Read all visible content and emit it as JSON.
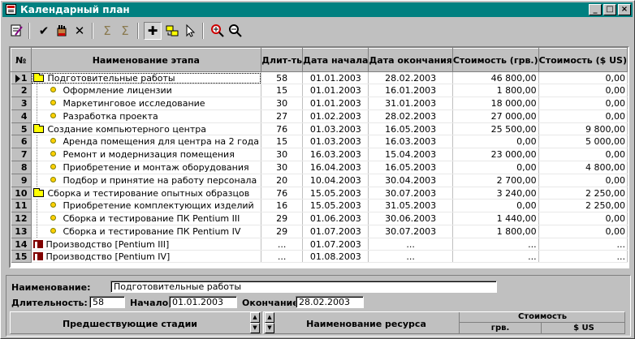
{
  "window": {
    "title": "Календарный план",
    "controls": [
      "_",
      "□",
      "×"
    ]
  },
  "toolbar": {
    "buttons": [
      {
        "icon": "document-edit-icon"
      },
      {
        "icon": "checkmark-icon",
        "glyph": "✔"
      },
      {
        "icon": "hand-icon"
      },
      {
        "icon": "delete-x-icon",
        "glyph": "✕"
      },
      {
        "icon": "sigma-icon",
        "glyph": "Σ"
      },
      {
        "icon": "sigma-icon",
        "glyph": "Σ"
      },
      {
        "icon": "plus-icon",
        "glyph": "✚"
      },
      {
        "icon": "move-icon"
      },
      {
        "icon": "pointer-icon"
      },
      {
        "icon": "zoom-in-icon"
      },
      {
        "icon": "zoom-out-icon"
      }
    ]
  },
  "table": {
    "columns": [
      "№",
      "Наименование этапа",
      "Длит-ть",
      "Дата начала",
      "Дата окончания",
      "Стоимость (грв.)",
      "Стоимость ($ US)"
    ],
    "rows": [
      {
        "num": "1",
        "name": "Подготовительные работы",
        "type": "folder",
        "dur": "58",
        "start": "01.01.2003",
        "end": "28.02.2003",
        "uah": "46 800,00",
        "usd": "0,00"
      },
      {
        "num": "2",
        "name": "Оформление лицензии",
        "type": "task",
        "dur": "15",
        "start": "01.01.2003",
        "end": "16.01.2003",
        "uah": "1 800,00",
        "usd": "0,00"
      },
      {
        "num": "3",
        "name": "Маркетинговое исследование",
        "type": "task",
        "dur": "30",
        "start": "01.01.2003",
        "end": "31.01.2003",
        "uah": "18 000,00",
        "usd": "0,00"
      },
      {
        "num": "4",
        "name": "Разработка проекта",
        "type": "task",
        "dur": "27",
        "start": "01.02.2003",
        "end": "28.02.2003",
        "uah": "27 000,00",
        "usd": "0,00"
      },
      {
        "num": "5",
        "name": "Создание компьютерного центра",
        "type": "folder",
        "dur": "76",
        "start": "01.03.2003",
        "end": "16.05.2003",
        "uah": "25 500,00",
        "usd": "9 800,00"
      },
      {
        "num": "6",
        "name": "Аренда помещения для центра на 2 года",
        "type": "task",
        "dur": "15",
        "start": "01.03.2003",
        "end": "16.03.2003",
        "uah": "0,00",
        "usd": "5 000,00"
      },
      {
        "num": "7",
        "name": "Ремонт и модернизация помещения",
        "type": "task",
        "dur": "30",
        "start": "16.03.2003",
        "end": "15.04.2003",
        "uah": "23 000,00",
        "usd": "0,00"
      },
      {
        "num": "8",
        "name": "Приобретение и монтаж оборудования",
        "type": "task",
        "dur": "30",
        "start": "16.04.2003",
        "end": "16.05.2003",
        "uah": "0,00",
        "usd": "4 800,00"
      },
      {
        "num": "9",
        "name": "Подбор и принятие на работу персонала",
        "type": "task",
        "dur": "20",
        "start": "10.04.2003",
        "end": "30.04.2003",
        "uah": "2 700,00",
        "usd": "0,00"
      },
      {
        "num": "10",
        "name": "Сборка и тестирование опытных образцов",
        "type": "folder",
        "dur": "76",
        "start": "15.05.2003",
        "end": "30.07.2003",
        "uah": "3 240,00",
        "usd": "2 250,00"
      },
      {
        "num": "11",
        "name": "Приобретение комплектующих изделий",
        "type": "task",
        "dur": "16",
        "start": "15.05.2003",
        "end": "31.05.2003",
        "uah": "0,00",
        "usd": "2 250,00"
      },
      {
        "num": "12",
        "name": "Сборка и тестирование ПК Pentium III",
        "type": "task",
        "dur": "29",
        "start": "01.06.2003",
        "end": "30.06.2003",
        "uah": "1 440,00",
        "usd": "0,00"
      },
      {
        "num": "13",
        "name": "Сборка и тестирование ПК Pentium IV",
        "type": "task",
        "dur": "29",
        "start": "01.07.2003",
        "end": "30.07.2003",
        "uah": "1 800,00",
        "usd": "0,00"
      },
      {
        "num": "14",
        "name": "Производство [Pentium III]",
        "type": "production",
        "dur": "...",
        "start": "01.07.2003",
        "end": "...",
        "uah": "...",
        "usd": "..."
      },
      {
        "num": "15",
        "name": "Производство [Pentium IV]",
        "type": "production",
        "dur": "...",
        "start": "01.08.2003",
        "end": "...",
        "uah": "...",
        "usd": "..."
      }
    ]
  },
  "details": {
    "name_label": "Наименование:",
    "name_value": "Подготовительные работы",
    "duration_label": "Длительность:",
    "duration_value": "58",
    "start_label": "Начало:",
    "start_value": "01.01.2003",
    "end_label": "Окончание:",
    "end_value": "28.02.2003"
  },
  "bottom_panels": {
    "predecessors": "Предшествующие стадии",
    "resource_name": "Наименование ресурса",
    "cost": "Стоимость",
    "uah": "грв.",
    "usd": "$ US"
  }
}
